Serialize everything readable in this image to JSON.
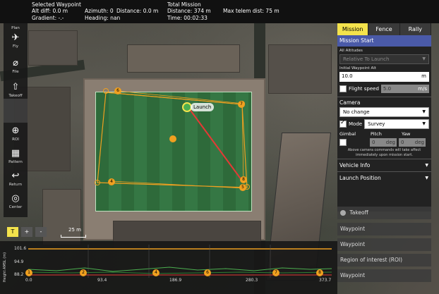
{
  "telemetry": {
    "selected_waypoint_label": "Selected Waypoint",
    "alt_diff": "Alt diff:    0.0 m",
    "gradient": "Gradient:  -.-",
    "azimuth": "Azimuth:  0",
    "heading": "Heading:  nan",
    "distance": "Distance:  0.0 m",
    "total_mission_label": "Total Mission",
    "total_distance": "Distance:  374 m",
    "time": "Time:        00:02:33",
    "max_telem_dist": "Max telem dist:  75 m"
  },
  "toolbar": {
    "plan": "Plan",
    "fly": "Fly",
    "file": "File",
    "takeoff": "Takeoff",
    "roi": "ROI",
    "pattern": "Pattern",
    "return": "Return",
    "center": "Center"
  },
  "map": {
    "launch_label": "Launch",
    "waypoint_numbers": [
      "6",
      "7",
      "8",
      "4",
      "5"
    ],
    "scale_label": "25 m",
    "zoom_buttons": [
      "T",
      "+",
      "-"
    ]
  },
  "panel": {
    "tabs": [
      "Mission",
      "Fence",
      "Rally"
    ],
    "active_tab": "Mission",
    "section_title": "Mission Start",
    "all_altitudes_label": "All Altitudes",
    "altitude_mode": "Relative To Launch",
    "initial_alt_label": "Initial Waypoint Alt",
    "initial_alt_value": "10.0",
    "initial_alt_unit": "m",
    "flight_speed_label": "Flight speed",
    "flight_speed_value": "5.0",
    "flight_speed_unit": "m/s",
    "camera_label": "Camera",
    "camera_value": "No change",
    "mode_label": "Mode",
    "mode_value": "Survey",
    "gimbal_label": "Gimbal",
    "pitch_label": "Pitch",
    "pitch_value": "0",
    "yaw_label": "Yaw",
    "yaw_value": "0",
    "deg_unit": "deg",
    "note": "Above camera commands will take affect immediately upon mission start.",
    "vehicle_info": "Vehicle Info",
    "launch_position": "Launch Position"
  },
  "mission_items": [
    "Takeoff",
    "Waypoint",
    "Waypoint",
    "Region of interest (ROI)",
    "Waypoint"
  ],
  "chart_data": {
    "type": "line",
    "ylabel": "Height AMSL (m)",
    "y_ticks": [
      "101.6",
      "94.9",
      "88.2"
    ],
    "x_ticks": [
      "0.0",
      "93.4",
      "186.9",
      "280.3",
      "373.7"
    ],
    "waypoint_markers": [
      "1",
      "2",
      "4",
      "6",
      "7",
      "8"
    ]
  },
  "colors": {
    "accent": "#f4e34c",
    "section": "#4a5aa8",
    "path": "#f0a020",
    "launch": "#4caf50"
  }
}
